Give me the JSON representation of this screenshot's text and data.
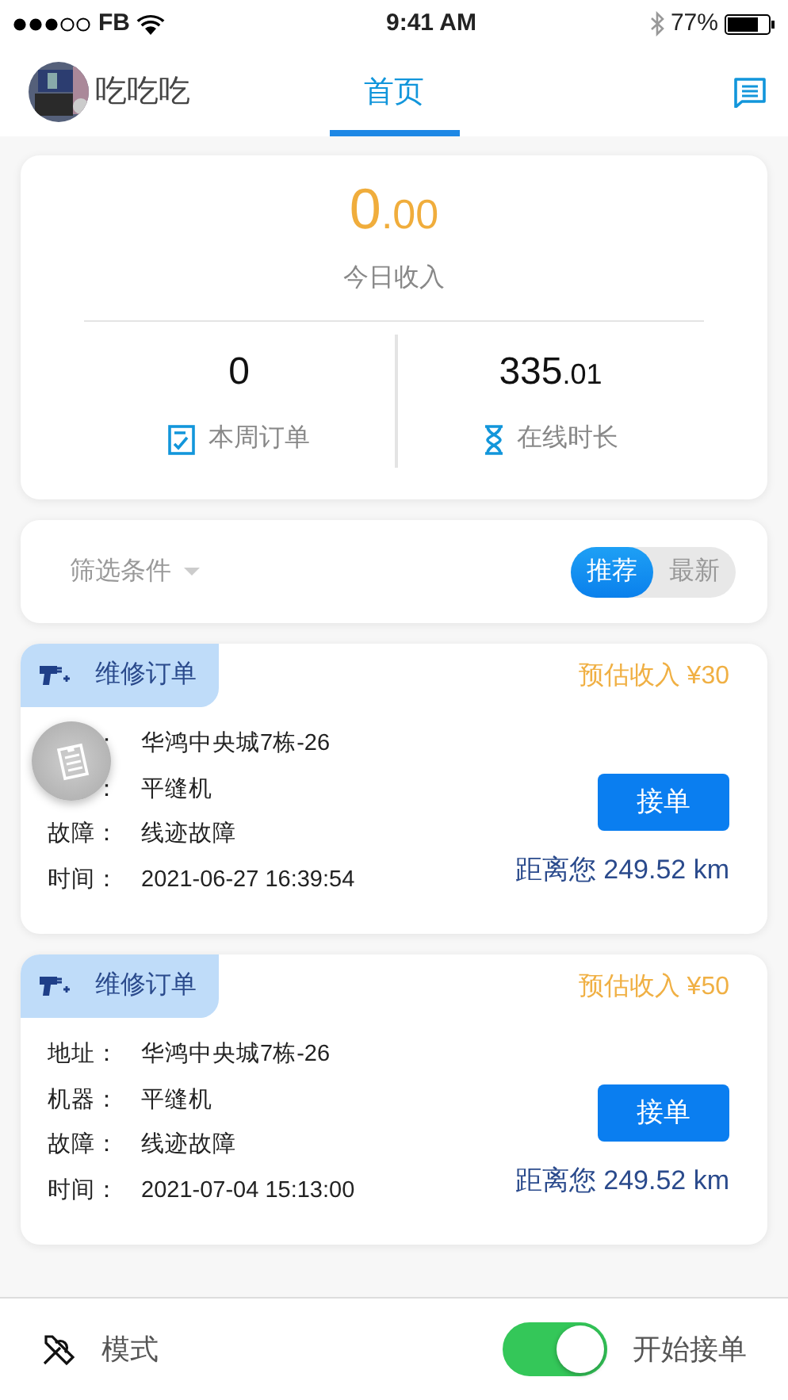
{
  "status_bar": {
    "carrier": "FB",
    "time": "9:41 AM",
    "battery": "77%"
  },
  "header": {
    "user_name": "吃吃吃",
    "tab": {
      "label": "首页",
      "selected": true
    }
  },
  "income": {
    "integer": "0",
    "decimal": ".00",
    "label": "今日收入"
  },
  "stats": [
    {
      "kind": "orders",
      "integer": "0",
      "label": "本周订单"
    },
    {
      "kind": "hours",
      "integer": "335",
      "decimal": ".01",
      "label": "在线时长"
    }
  ],
  "filter": {
    "label": "筛选条件",
    "sort_options": [
      {
        "label": "推荐",
        "selected": true
      },
      {
        "label": "最新",
        "selected": false
      }
    ]
  },
  "orders": [
    {
      "type": "维修订单",
      "earnings": "预估收入 ¥30",
      "fields": [
        {
          "label": "：",
          "value": "华鸿中央城7栋-26"
        },
        {
          "label": "：",
          "value": "平缝机"
        },
        {
          "label": "故障：",
          "value": "线迹故障"
        },
        {
          "label": "时间：",
          "value": "2021-06-27 16:39:54"
        }
      ],
      "button": "接单",
      "distance": "距离您 249.52 km"
    },
    {
      "type": "维修订单",
      "earnings": "预估收入 ¥50",
      "fields": [
        {
          "label": "地址：",
          "value": "华鸿中央城7栋-26"
        },
        {
          "label": "机器：",
          "value": "平缝机"
        },
        {
          "label": "故障：",
          "value": "线迹故障"
        },
        {
          "label": "时间：",
          "value": "2021-07-04 15:13:00"
        }
      ],
      "button": "接单",
      "distance": "距离您 249.52 km"
    }
  ],
  "bottom_bar": {
    "mode_label": "模式",
    "accept_label": "开始接单",
    "accept_on": true
  }
}
